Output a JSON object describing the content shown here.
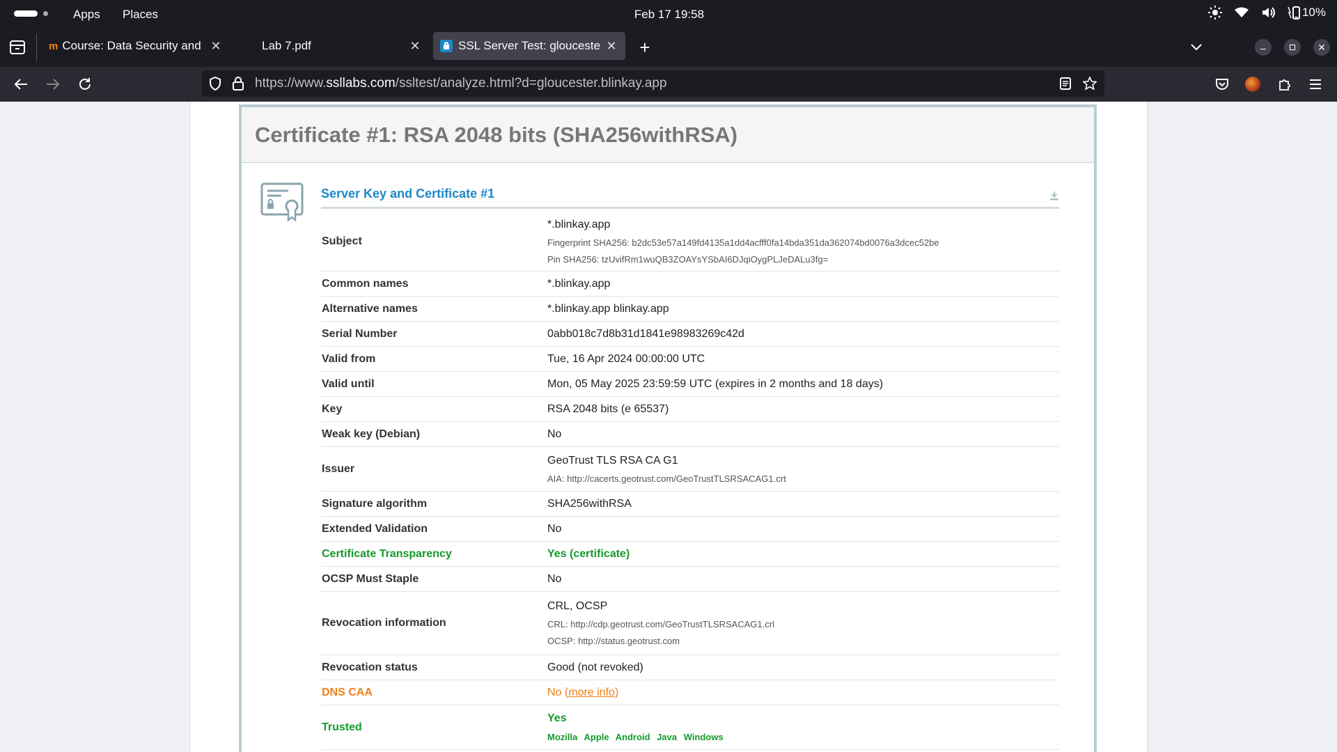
{
  "system": {
    "apps_label": "Apps",
    "places_label": "Places",
    "clock": "Feb 17  19:58",
    "battery": "10%"
  },
  "tabs": [
    {
      "label": "Course: Data Security and"
    },
    {
      "label": "Lab 7.pdf"
    },
    {
      "label": "SSL Server Test: glouceste"
    }
  ],
  "urlbar": {
    "prefix": "https://www.",
    "domain": "ssllabs.com",
    "path": "/ssltest/analyze.html?d=gloucester.blinkay.app"
  },
  "report": {
    "title": "Certificate #1: RSA 2048 bits (SHA256withRSA)",
    "section_title": "Server Key and Certificate #1",
    "rows": {
      "subject": {
        "label": "Subject",
        "value": "*.blinkay.app",
        "fingerprint": "Fingerprint SHA256: b2dc53e57a149fd4135a1dd4acfff0fa14bda351da362074bd0076a3dcec52be",
        "pin": "Pin SHA256: tzUvifRm1wuQB3ZOAYsYSbAI6DJqiOygPLJeDALu3fg="
      },
      "common_names": {
        "label": "Common names",
        "value": "*.blinkay.app"
      },
      "alt_names": {
        "label": "Alternative names",
        "value": "*.blinkay.app blinkay.app"
      },
      "serial": {
        "label": "Serial Number",
        "value": "0abb018c7d8b31d1841e98983269c42d"
      },
      "valid_from": {
        "label": "Valid from",
        "value": "Tue, 16 Apr 2024 00:00:00 UTC"
      },
      "valid_until": {
        "label": "Valid until",
        "value": "Mon, 05 May 2025 23:59:59 UTC (expires in 2 months and 18 days)"
      },
      "key": {
        "label": "Key",
        "value": "RSA 2048 bits (e 65537)"
      },
      "weak_key": {
        "label": "Weak key (Debian)",
        "value": "No"
      },
      "issuer": {
        "label": "Issuer",
        "value": "GeoTrust TLS RSA CA G1",
        "aia": "AIA: http://cacerts.geotrust.com/GeoTrustTLSRSACAG1.crt"
      },
      "sig_alg": {
        "label": "Signature algorithm",
        "value": "SHA256withRSA"
      },
      "ev": {
        "label": "Extended Validation",
        "value": "No"
      },
      "ct": {
        "label": "Certificate Transparency",
        "value": "Yes (certificate)"
      },
      "ocsp_staple": {
        "label": "OCSP Must Staple",
        "value": "No"
      },
      "revocation_info": {
        "label": "Revocation information",
        "value": "CRL, OCSP",
        "crl": "CRL: http://cdp.geotrust.com/GeoTrustTLSRSACAG1.crl",
        "ocsp": "OCSP: http://status.geotrust.com"
      },
      "revocation_status": {
        "label": "Revocation status",
        "value": "Good (not revoked)"
      },
      "dns_caa": {
        "label": "DNS CAA",
        "value": "No (",
        "link": "more info",
        "suffix": ")"
      },
      "trusted": {
        "label": "Trusted",
        "value": "Yes",
        "stores": [
          "Mozilla",
          "Apple",
          "Android",
          "Java",
          "Windows"
        ]
      }
    }
  },
  "colors": {
    "title_gray": "#777777",
    "link_blue": "#1b88c9",
    "ok_green": "#139a2a",
    "warn_orange": "#f07f13"
  }
}
